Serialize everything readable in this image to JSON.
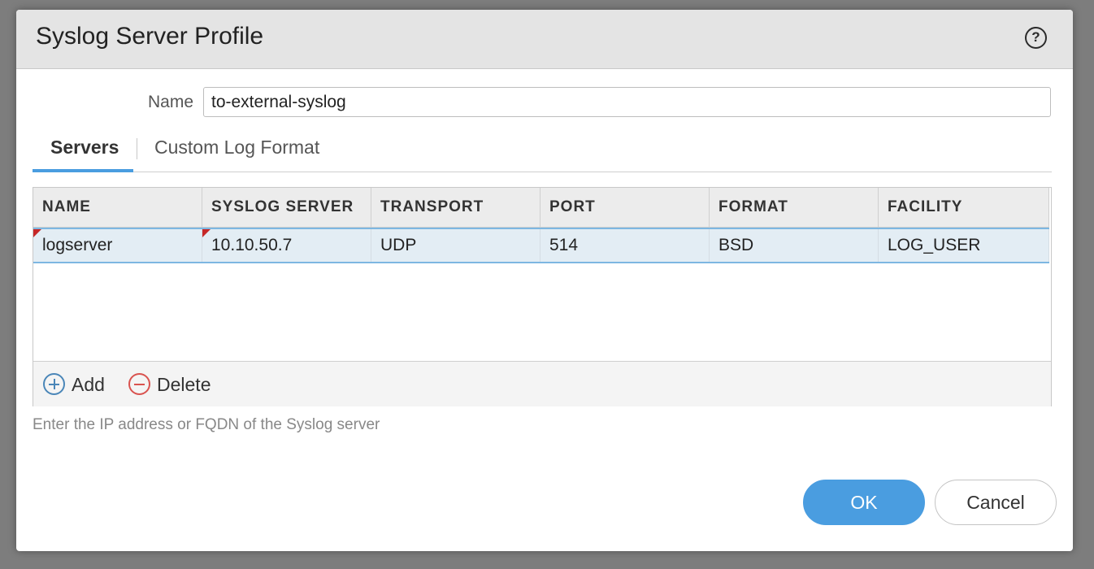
{
  "dialog": {
    "title": "Syslog Server Profile",
    "help_icon": "help-icon",
    "help_glyph": "?"
  },
  "form": {
    "name_label": "Name",
    "name_value": "to-external-syslog"
  },
  "tabs": [
    {
      "label": "Servers",
      "active": true
    },
    {
      "label": "Custom Log Format",
      "active": false
    }
  ],
  "grid": {
    "columns": [
      "NAME",
      "SYSLOG SERVER",
      "TRANSPORT",
      "PORT",
      "FORMAT",
      "FACILITY"
    ],
    "rows": [
      {
        "name": "logserver",
        "syslog_server": "10.10.50.7",
        "transport": "UDP",
        "port": "514",
        "format": "BSD",
        "facility": "LOG_USER",
        "selected": true
      }
    ],
    "add_label": "Add",
    "delete_label": "Delete",
    "add_icon": "plus-circle-icon",
    "delete_icon": "minus-circle-icon"
  },
  "hint": "Enter the IP address or FQDN of the Syslog server",
  "buttons": {
    "ok": "OK",
    "cancel": "Cancel"
  },
  "colors": {
    "accent": "#4a9de0",
    "selected_row": "#e3edf4",
    "required_marker": "#c62828",
    "delete": "#d9534f"
  }
}
